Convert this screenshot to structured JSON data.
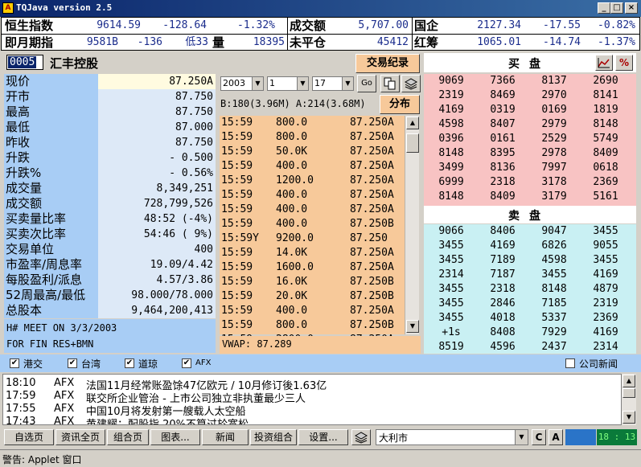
{
  "window": {
    "title": "TQJava version 2.5",
    "app_icon": "A",
    "minimize": "_",
    "maximize": "□",
    "close": "×"
  },
  "ticker": [
    {
      "name": "恒生指数",
      "value": "9614.59",
      "change": "-128.64",
      "pct": "-1.32%"
    },
    {
      "name": "即月期指",
      "value": "9581B",
      "change": "-136",
      "pct": "低33"
    },
    {
      "name": "成交额",
      "value": "5,707.00"
    },
    {
      "name": "量",
      "value": "18395"
    },
    {
      "name": "未平仓",
      "value": "45412"
    },
    {
      "name": "国企",
      "value": "2127.34",
      "change": "-17.55",
      "pct": "-0.82%"
    },
    {
      "name": "红筹",
      "value": "1065.01",
      "change": "-14.74",
      "pct": "-1.37%"
    }
  ],
  "stock": {
    "code": "0005",
    "name": "汇丰控股"
  },
  "quote": [
    {
      "label": "现价",
      "value": "87.250A"
    },
    {
      "label": "开市",
      "value": "87.750"
    },
    {
      "label": "最高",
      "value": "87.750"
    },
    {
      "label": "最低",
      "value": "87.000"
    },
    {
      "label": "昨收",
      "value": "87.750"
    },
    {
      "label": "升跌",
      "value": "- 0.500"
    },
    {
      "label": "升跌%",
      "value": "- 0.56%"
    },
    {
      "label": "成交量",
      "value": "8,349,251"
    },
    {
      "label": "成交额",
      "value": "728,799,526"
    },
    {
      "label": "买卖量比率",
      "value": "48:52 (-4%)"
    },
    {
      "label": "买卖次比率",
      "value": "54:46 ( 9%)"
    },
    {
      "label": "交易单位",
      "value": "400"
    },
    {
      "label": "市盈率/周息率",
      "value": "19.09/4.42"
    },
    {
      "label": "每股盈利/派息",
      "value": "4.57/3.86"
    },
    {
      "label": "52周最高/最低",
      "value": "98.000/78.000"
    },
    {
      "label": "总股本",
      "value": "9,464,200,413"
    }
  ],
  "news_box": {
    "line1": "H# MEET ON 3/3/2003",
    "line2": "FOR FIN RES+BMN"
  },
  "trade_log": {
    "button": "交易纪录",
    "year": "2003",
    "month": "1",
    "day": "17",
    "go": "Go",
    "buy_sell": "B:180(3.96M) A:214(3.68M)",
    "distribution": "分布",
    "vwap": "VWAP:  87.289",
    "trades": [
      {
        "time": "15:59",
        "vol": "800.0",
        "price": "87.250A"
      },
      {
        "time": "15:59",
        "vol": "800.0",
        "price": "87.250A"
      },
      {
        "time": "15:59",
        "vol": "50.0K",
        "price": "87.250A"
      },
      {
        "time": "15:59",
        "vol": "400.0",
        "price": "87.250A"
      },
      {
        "time": "15:59",
        "vol": "1200.0",
        "price": "87.250A"
      },
      {
        "time": "15:59",
        "vol": "400.0",
        "price": "87.250A"
      },
      {
        "time": "15:59",
        "vol": "400.0",
        "price": "87.250A"
      },
      {
        "time": "15:59",
        "vol": "400.0",
        "price": "87.250B"
      },
      {
        "time": "15:59Y",
        "vol": "9200.0",
        "price": "87.250"
      },
      {
        "time": "15:59",
        "vol": "14.0K",
        "price": "87.250A"
      },
      {
        "time": "15:59",
        "vol": "1600.0",
        "price": "87.250A"
      },
      {
        "time": "15:59",
        "vol": "16.0K",
        "price": "87.250B"
      },
      {
        "time": "15:59",
        "vol": "20.0K",
        "price": "87.250B"
      },
      {
        "time": "15:59",
        "vol": "400.0",
        "price": "87.250A"
      },
      {
        "time": "15:59",
        "vol": "800.0",
        "price": "87.250B"
      },
      {
        "time": "15:59",
        "vol": "2800.0",
        "price": "87.250A"
      }
    ]
  },
  "bid_header": "买盘",
  "ask_header": "卖盘",
  "bid": [
    [
      "9069",
      "7366",
      "8137",
      "2690"
    ],
    [
      "2319",
      "8469",
      "2970",
      "8141"
    ],
    [
      "4169",
      "0319",
      "0169",
      "1819"
    ],
    [
      "4598",
      "8407",
      "2979",
      "8148"
    ],
    [
      "0396",
      "0161",
      "2529",
      "5749"
    ],
    [
      "8148",
      "8395",
      "2978",
      "8409"
    ],
    [
      "3499",
      "8136",
      "7997",
      "0618"
    ],
    [
      "6999",
      "2318",
      "3178",
      "2369"
    ],
    [
      "8148",
      "8409",
      "3179",
      "5161"
    ],
    [
      "6439",
      "2316",
      "8395",
      "8148"
    ]
  ],
  "ask": [
    [
      "9066",
      "8406",
      "9047",
      "3455"
    ],
    [
      "3455",
      "4169",
      "6826",
      "9055"
    ],
    [
      "3455",
      "7189",
      "4598",
      "3455"
    ],
    [
      "2314",
      "7187",
      "3455",
      "4169"
    ],
    [
      "3455",
      "2318",
      "8148",
      "4879"
    ],
    [
      "3455",
      "2846",
      "7185",
      "2319"
    ],
    [
      "3455",
      "4018",
      "5337",
      "2369"
    ],
    [
      "+1s",
      "8408",
      "7929",
      "4169"
    ],
    [
      "8519",
      "4596",
      "2437",
      "2314"
    ],
    [
      "7137",
      "8399",
      "4169",
      "8148"
    ]
  ],
  "news_sources": [
    "港交",
    "台湾",
    "道琼",
    "AFX"
  ],
  "company_news": "公司新闻",
  "check_mark": "✔",
  "news": [
    {
      "time": "18:10",
      "src": "AFX",
      "headline": "法国11月经常账盈馀47亿欧元 / 10月修订後1.63亿"
    },
    {
      "time": "17:59",
      "src": "AFX",
      "headline": "联交所企业管治 - 上市公司独立非执董最少三人"
    },
    {
      "time": "17:55",
      "src": "AFX",
      "headline": "中国10月将发射第一艘载人太空船"
    },
    {
      "time": "17:43",
      "src": "AFX",
      "headline": "黄建耀：配股指 20%不算过於宽松"
    }
  ],
  "bottom_buttons": [
    "自选页",
    "资讯全页",
    "组合页",
    "图表...",
    "新闻",
    "投资组合",
    "设置..."
  ],
  "market_select": "大利市",
  "btn_c": "C",
  "btn_a": "A",
  "clock": "18 : 13",
  "status": "警告: Applet 窗口"
}
